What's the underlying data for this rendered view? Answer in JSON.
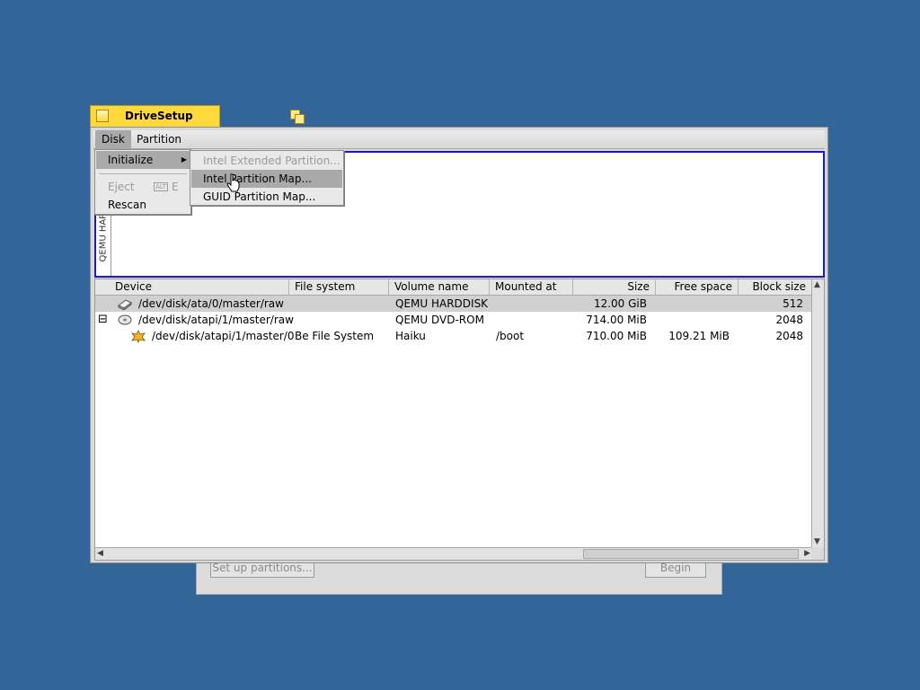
{
  "window": {
    "title": "DriveSetup"
  },
  "menubar": {
    "disk": "Disk",
    "partition": "Partition"
  },
  "disk_menu": {
    "initialize": "Initialize",
    "eject": "Eject",
    "eject_shortcut_mod": "ALT",
    "eject_shortcut_key": "E",
    "rescan": "Rescan"
  },
  "initialize_submenu": {
    "extended": "Intel Extended Partition...",
    "intel_map": "Intel Partition Map...",
    "guid_map": "GUID Partition Map..."
  },
  "disk_map": {
    "vertical_label": "QEMU HARDDISK"
  },
  "columns": [
    "Device",
    "File system",
    "Volume name",
    "Mounted at",
    "Size",
    "Free space",
    "Block size"
  ],
  "rows": [
    {
      "device": "/dev/disk/ata/0/master/raw",
      "fs": "",
      "volume": "QEMU HARDDISK",
      "mounted": "",
      "size": "12.00 GiB",
      "free": "",
      "block": "512"
    },
    {
      "device": "/dev/disk/atapi/1/master/raw",
      "fs": "",
      "volume": "QEMU DVD-ROM",
      "mounted": "",
      "size": "714.00 MiB",
      "free": "",
      "block": "2048"
    },
    {
      "device": "/dev/disk/atapi/1/master/0",
      "fs": "Be File System",
      "volume": "Haiku",
      "mounted": "/boot",
      "size": "710.00 MiB",
      "free": "109.21 MiB",
      "block": "2048"
    }
  ],
  "tree_toggle": "⊟",
  "background_dialog": {
    "setup_button": "Set up partitions...",
    "begin_button": "Begin"
  },
  "colors": {
    "desktop": "#336698",
    "tab": "#ffd83c",
    "selection": "#a9a9a9"
  }
}
